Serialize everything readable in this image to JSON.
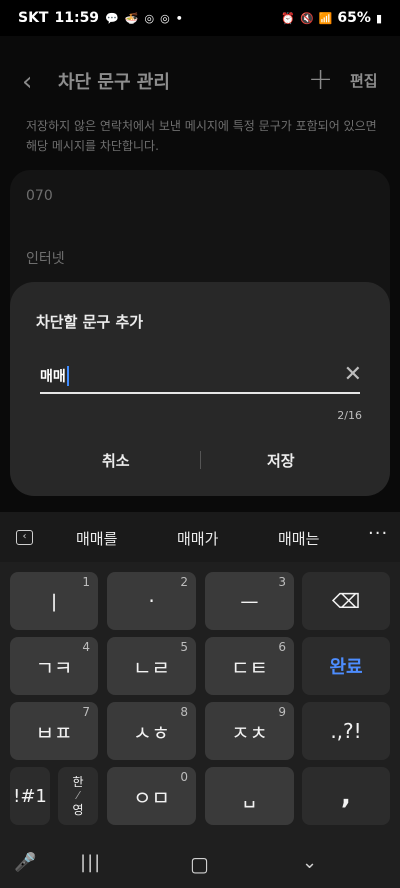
{
  "status": {
    "carrier": "SKT",
    "time": "11:59",
    "battery": "65%"
  },
  "app": {
    "title": "차단 문구 관리",
    "add_label": "+",
    "edit_label": "편집",
    "description": "저장하지 않은 연락처에서 보낸 메시지에 특정 문구가 포함되어 있으면 해당 메시지를 차단합니다.",
    "list": [
      "070",
      "인터넷"
    ]
  },
  "dialog": {
    "title": "차단할 문구 추가",
    "input_value": "매매",
    "counter": "2/16",
    "cancel_label": "취소",
    "save_label": "저장"
  },
  "keyboard": {
    "suggestions": [
      "매매를",
      "매매가",
      "매매는"
    ],
    "rows": [
      [
        {
          "label": "ㅣ",
          "hint": "1"
        },
        {
          "label": "·",
          "hint": "2"
        },
        {
          "label": "ㅡ",
          "hint": "3"
        },
        {
          "label": "⌫",
          "hint": ""
        }
      ],
      [
        {
          "label": "ㄱㅋ",
          "hint": "4"
        },
        {
          "label": "ㄴㄹ",
          "hint": "5"
        },
        {
          "label": "ㄷㅌ",
          "hint": "6"
        },
        {
          "label": "완료",
          "hint": ""
        }
      ],
      [
        {
          "label": "ㅂㅍ",
          "hint": "7"
        },
        {
          "label": "ㅅㅎ",
          "hint": "8"
        },
        {
          "label": "ㅈㅊ",
          "hint": "9"
        },
        {
          "label": ".,?!",
          "hint": ""
        }
      ]
    ],
    "bottom": {
      "symbols": "!#1",
      "lang_top": "한",
      "lang_bottom": "영",
      "oms": "ㅇㅁ",
      "oms_hint": "0",
      "space": "␣",
      "comma": ","
    }
  },
  "colors": {
    "accent": "#4d8dff",
    "dialog_bg": "#282828",
    "key_bg": "#3a3a3a"
  }
}
